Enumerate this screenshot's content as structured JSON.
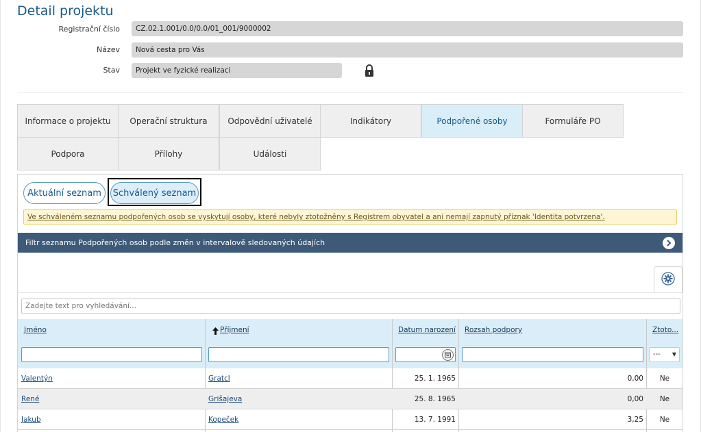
{
  "page": {
    "title": "Detail projektu"
  },
  "project": {
    "reg_label": "Registrační číslo",
    "reg_value": "CZ.02.1.001/0.0/0.0/01_001/9000002",
    "name_label": "Název",
    "name_value": "Nová cesta pro Vás",
    "state_label": "Stav",
    "state_value": "Projekt ve fyzické realizaci",
    "lock_icon": "lock-icon"
  },
  "tabs": [
    {
      "label": "Informace o projektu",
      "active": false
    },
    {
      "label": "Operační struktura",
      "active": false
    },
    {
      "label": "Odpovědní uživatelé",
      "active": false
    },
    {
      "label": "Indikátory",
      "active": false
    },
    {
      "label": "Podpořené osoby",
      "active": true
    },
    {
      "label": "Formuláře PO",
      "active": false
    },
    {
      "label": "Podpora",
      "active": false
    },
    {
      "label": "Přílohy",
      "active": false
    },
    {
      "label": "Události",
      "active": false
    }
  ],
  "list_toggle": {
    "current_label": "Aktuální seznam",
    "approved_label": "Schválený seznam",
    "selected": "approved"
  },
  "warning": {
    "text": "Ve schváleném seznamu podpořených osob se vyskytují osoby, které nebyly ztotožněny s Registrem obyvatel a ani nemají zapnutý příznak 'Identita potvrzena'."
  },
  "filter_panel": {
    "title": "Filtr seznamu Podpořených osob podle změn v intervalově sledovaných údajích",
    "icon": "chevron-right-icon"
  },
  "settings": {
    "icon": "gear-icon"
  },
  "search": {
    "placeholder": "Zadejte text pro vyhledávání...",
    "value": ""
  },
  "grid": {
    "columns": [
      "Jméno",
      "Příjmení",
      "Datum narození",
      "Rozsah podpory",
      "Ztoto..."
    ],
    "sort_icon": "arrow-up-icon",
    "identity_filter_value": "---",
    "rows": [
      {
        "first": "Valentýn",
        "last": "Gratcl",
        "birth": "25. 1. 1965",
        "scope": "0,00",
        "identity": "Ne"
      },
      {
        "first": "René",
        "last": "Grišajeva",
        "birth": "25. 8. 1965",
        "scope": "0,00",
        "identity": "Ne"
      },
      {
        "first": "Jakub",
        "last": "Kopeček",
        "birth": "13. 7. 1991",
        "scope": "3,25",
        "identity": "Ne"
      }
    ]
  },
  "colors": {
    "accent": "#1a5a8a",
    "filter_bar": "#3d5a78",
    "active_tab": "#d9eef8",
    "warning_bg": "#fdf5d3"
  }
}
